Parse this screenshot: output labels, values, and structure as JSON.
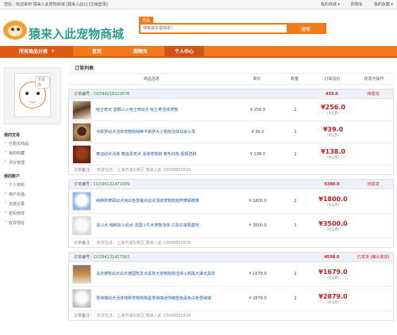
{
  "topbar": {
    "welcome": "您好，欢迎来到 猿来入此宠物商城",
    "login_info": "[猿来入此1] [注销登录]",
    "my_mall": "我的商城",
    "cart": "购物车",
    "favorites": "我的收藏"
  },
  "header": {
    "site_name": "猿来入此宠物商城",
    "search_tag": "商品",
    "search_placeholder": "搜索其实很简单！",
    "search_button": "搜索"
  },
  "nav": {
    "all_categories": "所有商品分类",
    "items": [
      {
        "label": "首页",
        "active": false
      },
      {
        "label": "购物车",
        "active": false
      },
      {
        "label": "个人中心",
        "active": true
      }
    ]
  },
  "sidebar": {
    "avatar_label": "求真像",
    "sections": [
      {
        "title": "我的交易",
        "links": [
          "已购买商品",
          "我的收藏",
          "评价管理"
        ]
      },
      {
        "title": "我的账户",
        "links": [
          "个人资料",
          "用户充值",
          "充值记录",
          "密码修改",
          "收货地址"
        ]
      }
    ]
  },
  "main": {
    "title": "订单列表",
    "columns": [
      "商品信息",
      "单价",
      "数量",
      "订单总价",
      "状态与操作"
    ],
    "order_label": "订单编号：",
    "remark_label": "订单备注：",
    "orders": [
      {
        "id": "O1594218223576",
        "total": "433.0",
        "status": "待发货",
        "remark": "收货信息：上海市浦东新区 猿来入此 13998893839",
        "products": [
          {
            "name": "哈士奇犬 蓝眼三火哈士奇幼犬 哈士奇活体宠物",
            "price": "¥ 256.0",
            "qty": "1",
            "total": "¥256.0",
            "note": "(免运费)"
          },
          {
            "name": "卡斯罗幼犬活体宠物狗纯种卡斯罗大小狗狗活体幼崽公母",
            "price": "¥ 39.0",
            "qty": "1",
            "total": "¥39.0",
            "note": "(免运费)"
          },
          {
            "name": "泰迪幼犬活体 泰迪贵宾犬 活体宠物狗 卷毛红色 视频选狗",
            "price": "¥ 138.0",
            "qty": "1",
            "total": "¥138.0",
            "note": "(免运费)"
          }
        ]
      },
      {
        "id": "O1594131471689",
        "total": "5300.0",
        "status": "待发货",
        "remark": "收货信息：上海市浦东新区 猿来入此 13998893839",
        "products": [
          {
            "name": "纯种萨摩耶幼犬纯白色雪橇犬幼犬活体宠物狗狗萨摩耶微笑",
            "price": "¥ 1800.0",
            "qty": "1",
            "total": "¥1800.0",
            "note": "(免运费)"
          },
          {
            "name": "法斗犬 纯种法斗幼犬 法国斗牛犬宠物活体 江浙沪来隔基地",
            "price": "¥ 3500.0",
            "qty": "1",
            "total": "¥3500.0",
            "note": "(免运费)"
          }
        ]
      },
      {
        "id": "O1594131417563",
        "total": "4558.0",
        "status": "已发货 [确认收货]",
        "remark": "收货信息：上海市浦东新区 猿来入此 13998893839",
        "products": [
          {
            "name": "马犬德牧幼犬幼犬德国牧羊犬黑背犬宠物狗狗活体小狗黑大狼犬黑背",
            "price": "¥ 1679.0",
            "qty": "1",
            "total": "¥1679.0",
            "note": "(免运费)"
          },
          {
            "name": "雪纳瑞幼犬活体纯种宠物狗狗黑雪纳瑞迷你椒盐色黑色白色雪纳瑞",
            "price": "¥ 2879.0",
            "qty": "1",
            "total": "¥2879.0",
            "note": "(免运费)"
          }
        ]
      }
    ]
  }
}
